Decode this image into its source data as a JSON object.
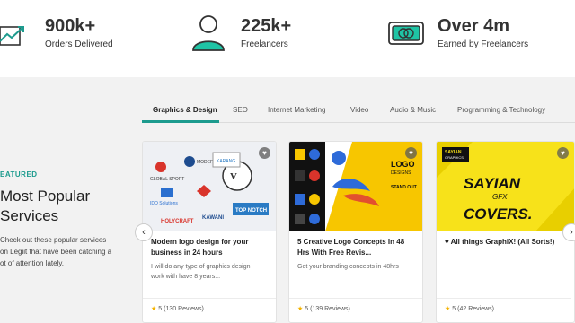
{
  "stats": [
    {
      "icon": "trend-up-icon",
      "number": "900k+",
      "label": "Orders Delivered"
    },
    {
      "icon": "person-icon",
      "number": "225k+",
      "label": "Freelancers"
    },
    {
      "icon": "money-icon",
      "number": "Over 4m",
      "label": "Earned by Freelancers"
    }
  ],
  "tabs": [
    "Graphics & Design",
    "SEO",
    "Internet Marketing",
    "Video",
    "Audio & Music",
    "Programming & Technology"
  ],
  "active_tab": "Graphics & Design",
  "section": {
    "eyebrow": "EATURED",
    "title": "Most Popular\nServices",
    "description": "Check out these popular services\non Legiit that have been catching a\not of attention lately."
  },
  "cards": [
    {
      "title": "Modern logo design for your business in 24 hours",
      "description": "I will do any type of graphics design\nwork with have 8 years...",
      "rating": "5",
      "reviews": "(130 Reviews)",
      "thumb_logos": [
        "GLOBAL SPORT",
        "MODERN",
        "KARANG",
        "HOLYCRAFT",
        "KAWANI",
        "TOP NOTCH",
        "IDO Solutions"
      ]
    },
    {
      "title": "5 Creative Logo Concepts In 48 Hrs With Free Revis...",
      "description": "Get your branding concepts in 48hrs",
      "rating": "5",
      "reviews": "(139 Reviews)",
      "thumb_text": [
        "LOGO",
        "DESIGNS",
        "STAND OUT"
      ]
    },
    {
      "title": "♥ All things GraphiX! (All Sorts!)",
      "description": "",
      "rating": "5",
      "reviews": "(42 Reviews)",
      "thumb_text": [
        "SAYIAN",
        "GRAPHICS.",
        "SAYIAN",
        "GFX",
        "COVERS."
      ]
    }
  ],
  "colors": {
    "accent": "#1d9b8e",
    "star": "#f5b300",
    "yellow": "#f7e21a"
  }
}
